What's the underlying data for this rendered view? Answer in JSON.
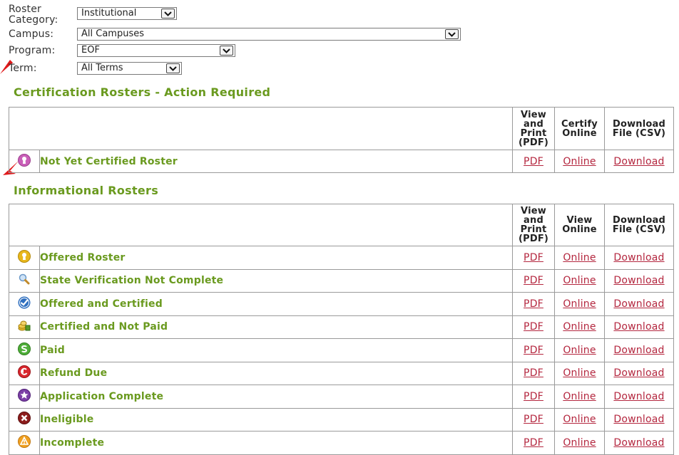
{
  "filters": {
    "roster_category_label_line1": "Roster",
    "roster_category_label_line2": "Category:",
    "roster_category_value": "Institutional",
    "campus_label": "Campus:",
    "campus_value": "All Campuses",
    "program_label": "Program:",
    "program_value": "EOF",
    "term_label": "Term:",
    "term_value": "All Terms"
  },
  "certification": {
    "title": "Certification Rosters - Action Required",
    "headers": {
      "col1": [
        "View",
        "and",
        "Print",
        "(PDF)"
      ],
      "col2": [
        "Certify",
        "Online"
      ],
      "col3": [
        "Download",
        "File (CSV)"
      ]
    },
    "rows": [
      {
        "icon": "pink-keyhole-icon",
        "name": "Not Yet Certified Roster",
        "pdf": "PDF",
        "online": "Online",
        "download": "Download"
      }
    ]
  },
  "informational": {
    "title": "Informational Rosters",
    "headers": {
      "col1": [
        "View",
        "and",
        "Print",
        "(PDF)"
      ],
      "col2": [
        "View",
        "Online"
      ],
      "col3": [
        "Download",
        "File (CSV)"
      ]
    },
    "rows": [
      {
        "icon": "yellow-keyhole-icon",
        "name": "Offered Roster",
        "pdf": "PDF",
        "online": "Online",
        "download": "Download"
      },
      {
        "icon": "magnifier-icon",
        "name": "State Verification Not Complete",
        "pdf": "PDF",
        "online": "Online",
        "download": "Download"
      },
      {
        "icon": "blue-check-icon",
        "name": "Offered and Certified",
        "pdf": "PDF",
        "online": "Online",
        "download": "Download"
      },
      {
        "icon": "coins-icon",
        "name": "Certified and Not Paid",
        "pdf": "PDF",
        "online": "Online",
        "download": "Download"
      },
      {
        "icon": "green-dollar-icon",
        "name": "Paid",
        "pdf": "PDF",
        "online": "Online",
        "download": "Download"
      },
      {
        "icon": "red-refund-icon",
        "name": "Refund Due",
        "pdf": "PDF",
        "online": "Online",
        "download": "Download"
      },
      {
        "icon": "purple-star-icon",
        "name": "Application Complete",
        "pdf": "PDF",
        "online": "Online",
        "download": "Download"
      },
      {
        "icon": "red-x-icon",
        "name": "Ineligible",
        "pdf": "PDF",
        "online": "Online",
        "download": "Download"
      },
      {
        "icon": "orange-warning-icon",
        "name": "Incomplete",
        "pdf": "PDF",
        "online": "Online",
        "download": "Download"
      }
    ]
  },
  "colors": {
    "section_title": "#6a9a1f",
    "link": "#b4273f",
    "annotation_arrow": "#e0191b"
  }
}
